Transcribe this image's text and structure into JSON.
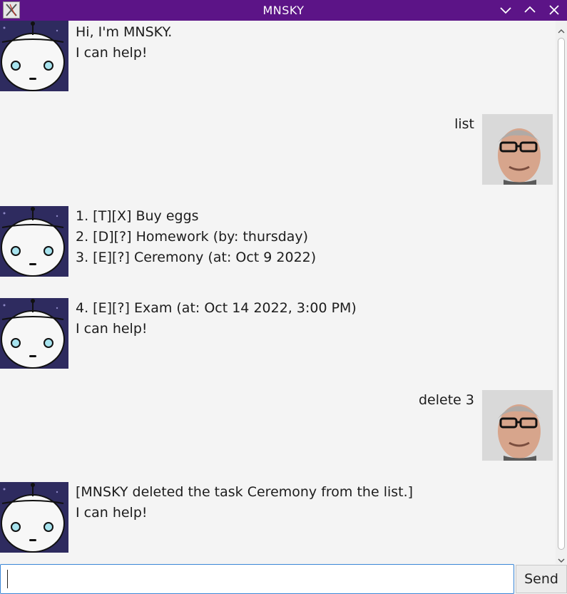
{
  "window": {
    "title": "MNSKY",
    "app_icon": "x-window-icon",
    "controls": [
      "minimize-icon",
      "maximize-icon",
      "close-icon"
    ],
    "titlebar_color": "#5c1487"
  },
  "messages": [
    {
      "sender": "bot",
      "lines": [
        "Hi, I'm MNSKY.",
        "I can help!"
      ]
    },
    {
      "sender": "user",
      "lines": [
        "list"
      ]
    },
    {
      "sender": "bot",
      "lines": [
        "1. [T][X] Buy eggs",
        "2. [D][?] Homework (by: thursday)",
        "3. [E][?] Ceremony (at: Oct 9 2022)"
      ]
    },
    {
      "sender": "bot",
      "lines": [
        "4. [E][?] Exam (at: Oct 14 2022, 3:00 PM)",
        "I can help!"
      ]
    },
    {
      "sender": "user",
      "lines": [
        "delete 3"
      ]
    },
    {
      "sender": "bot",
      "lines": [
        "[MNSKY deleted the task Ceremony from the list.]",
        "I can help!"
      ]
    }
  ],
  "input": {
    "value": "",
    "placeholder": ""
  },
  "send_button": {
    "label": "Send"
  }
}
